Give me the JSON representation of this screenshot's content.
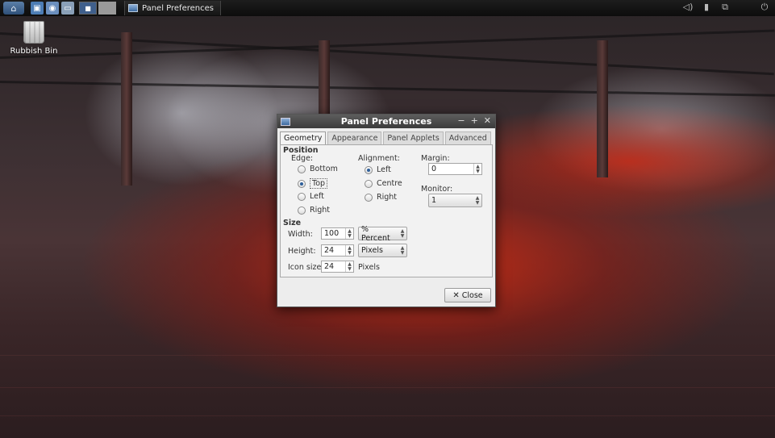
{
  "desktop": {
    "icons": [
      {
        "label": "Rubbish Bin",
        "icon": "trash-icon"
      }
    ]
  },
  "panel": {
    "task_title": "Panel Preferences"
  },
  "dialog": {
    "title": "Panel Preferences",
    "tabs": [
      "Geometry",
      "Appearance",
      "Panel Applets",
      "Advanced"
    ],
    "active_tab": "Geometry",
    "position": {
      "heading": "Position",
      "edge_label": "Edge:",
      "edge_options": [
        "Bottom",
        "Top",
        "Left",
        "Right"
      ],
      "edge_selected": "Top",
      "alignment_label": "Alignment:",
      "alignment_options": [
        "Left",
        "Centre",
        "Right"
      ],
      "alignment_selected": "Left",
      "margin_label": "Margin:",
      "margin_value": "0",
      "monitor_label": "Monitor:",
      "monitor_value": "1"
    },
    "size": {
      "heading": "Size",
      "width_label": "Width:",
      "width_value": "100",
      "width_unit": "% Percent",
      "height_label": "Height:",
      "height_value": "24",
      "height_unit": "Pixels",
      "icon_size_label": "Icon size:",
      "icon_size_value": "24",
      "icon_size_unit": "Pixels"
    },
    "close_label": "Close"
  }
}
